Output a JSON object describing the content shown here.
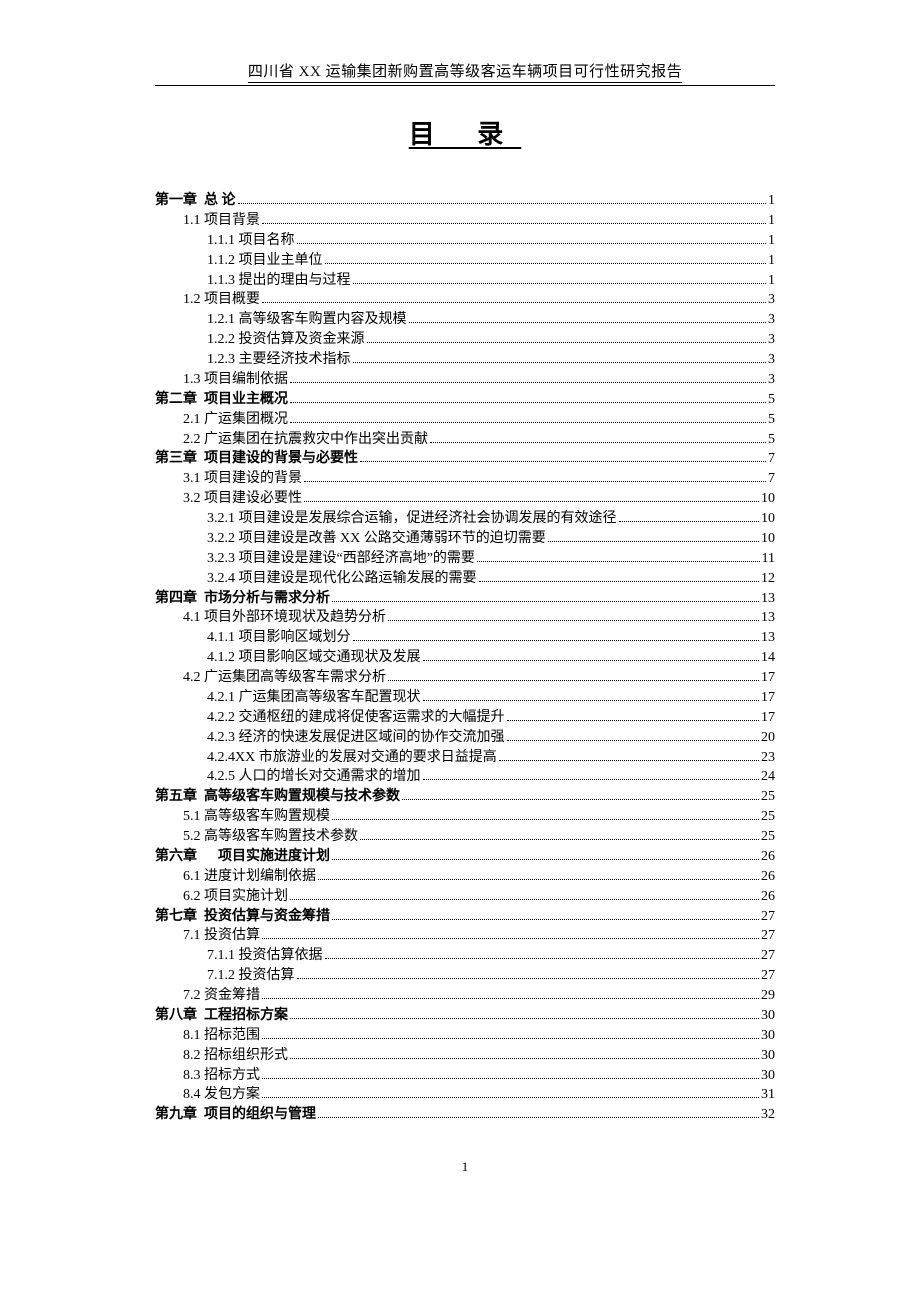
{
  "header": "四川省 XX 运输集团新购置高等级客运车辆项目可行性研究报告",
  "title": "目 录",
  "page_number": "1",
  "toc": [
    {
      "level": 0,
      "label": "第一章  总 论",
      "page": "1"
    },
    {
      "level": 1,
      "label": "1.1 项目背景",
      "page": "1"
    },
    {
      "level": 2,
      "label": "1.1.1 项目名称",
      "page": "1"
    },
    {
      "level": 2,
      "label": "1.1.2 项目业主单位",
      "page": "1"
    },
    {
      "level": 2,
      "label": "1.1.3 提出的理由与过程",
      "page": "1"
    },
    {
      "level": 1,
      "label": "1.2 项目概要",
      "page": "3"
    },
    {
      "level": 2,
      "label": "1.2.1 高等级客车购置内容及规模",
      "page": "3"
    },
    {
      "level": 2,
      "label": "1.2.2 投资估算及资金来源",
      "page": "3"
    },
    {
      "level": 2,
      "label": "1.2.3 主要经济技术指标",
      "page": "3"
    },
    {
      "level": 1,
      "label": "1.3 项目编制依据",
      "page": "3"
    },
    {
      "level": 0,
      "label": "第二章  项目业主概况",
      "page": "5"
    },
    {
      "level": 1,
      "label": "2.1 广运集团概况",
      "page": "5"
    },
    {
      "level": 1,
      "label": "2.2 广运集团在抗震救灾中作出突出贡献",
      "page": "5"
    },
    {
      "level": 0,
      "label": "第三章  项目建设的背景与必要性",
      "page": "7"
    },
    {
      "level": 1,
      "label": "3.1 项目建设的背景",
      "page": "7"
    },
    {
      "level": 1,
      "label": "3.2 项目建设必要性",
      "page": "10"
    },
    {
      "level": 2,
      "label": "3.2.1 项目建设是发展综合运输，促进经济社会协调发展的有效途径",
      "page": "10"
    },
    {
      "level": 2,
      "label": "3.2.2 项目建设是改善 XX 公路交通薄弱环节的迫切需要",
      "page": "10"
    },
    {
      "level": 2,
      "label": "3.2.3 项目建设是建设“西部经济高地”的需要",
      "page": "11"
    },
    {
      "level": 2,
      "label": "3.2.4 项目建设是现代化公路运输发展的需要",
      "page": "12"
    },
    {
      "level": 0,
      "label": "第四章  市场分析与需求分析",
      "page": "13"
    },
    {
      "level": 1,
      "label": "4.1 项目外部环境现状及趋势分析",
      "page": "13"
    },
    {
      "level": 2,
      "label": "4.1.1 项目影响区域划分",
      "page": "13"
    },
    {
      "level": 2,
      "label": "4.1.2 项目影响区域交通现状及发展",
      "page": "14"
    },
    {
      "level": 1,
      "label": "4.2 广运集团高等级客车需求分析",
      "page": "17"
    },
    {
      "level": 2,
      "label": "4.2.1 广运集团高等级客车配置现状",
      "page": "17"
    },
    {
      "level": 2,
      "label": "4.2.2 交通枢纽的建成将促使客运需求的大幅提升",
      "page": "17"
    },
    {
      "level": 2,
      "label": "4.2.3 经济的快速发展促进区域间的协作交流加强",
      "page": "20"
    },
    {
      "level": 2,
      "label": "4.2.4XX 市旅游业的发展对交通的要求日益提高",
      "page": "23"
    },
    {
      "level": 2,
      "label": "4.2.5 人口的增长对交通需求的增加",
      "page": "24"
    },
    {
      "level": 0,
      "label": "第五章  高等级客车购置规模与技术参数",
      "page": "25"
    },
    {
      "level": 1,
      "label": "5.1 高等级客车购置规模",
      "page": "25"
    },
    {
      "level": 1,
      "label": "5.2 高等级客车购置技术参数",
      "page": "25"
    },
    {
      "level": 0,
      "label": "第六章      项目实施进度计划",
      "page": "26"
    },
    {
      "level": 1,
      "label": "6.1 进度计划编制依据",
      "page": "26"
    },
    {
      "level": 1,
      "label": "6.2 项目实施计划",
      "page": "26"
    },
    {
      "level": 0,
      "label": "第七章  投资估算与资金筹措",
      "page": "27"
    },
    {
      "level": 1,
      "label": "7.1 投资估算",
      "page": "27"
    },
    {
      "level": 2,
      "label": "7.1.1 投资估算依据",
      "page": "27"
    },
    {
      "level": 2,
      "label": "7.1.2 投资估算",
      "page": "27"
    },
    {
      "level": 1,
      "label": "7.2 资金筹措",
      "page": "29"
    },
    {
      "level": 0,
      "label": "第八章  工程招标方案",
      "page": "30"
    },
    {
      "level": 1,
      "label": "8.1 招标范围",
      "page": "30"
    },
    {
      "level": 1,
      "label": "8.2 招标组织形式",
      "page": "30"
    },
    {
      "level": 1,
      "label": "8.3 招标方式",
      "page": "30"
    },
    {
      "level": 1,
      "label": "8.4 发包方案",
      "page": "31"
    },
    {
      "level": 0,
      "label": "第九章  项目的组织与管理",
      "page": "32"
    }
  ]
}
